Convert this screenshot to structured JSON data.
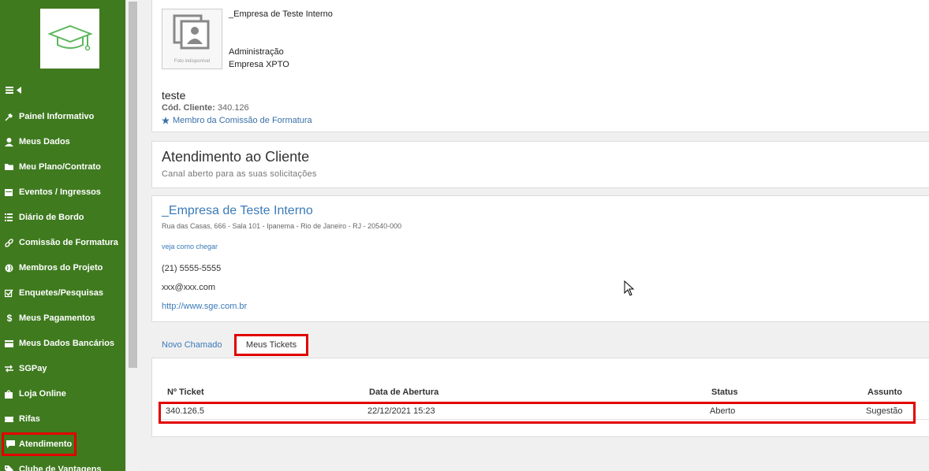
{
  "sidebar": {
    "logo": "graduation-cap-logo",
    "toggle_icons": [
      "hamburger-icon",
      "caret-left-icon"
    ],
    "items": [
      {
        "label": "Painel Informativo",
        "icon": "pin-icon"
      },
      {
        "label": "Meus Dados",
        "icon": "user-icon"
      },
      {
        "label": "Meu Plano/Contrato",
        "icon": "folder-icon"
      },
      {
        "label": "Eventos / Ingressos",
        "icon": "calendar-icon"
      },
      {
        "label": "Diário de Bordo",
        "icon": "list-icon"
      },
      {
        "label": "Comissão de Formatura",
        "icon": "link-icon"
      },
      {
        "label": "Membros do Projeto",
        "icon": "globe-icon"
      },
      {
        "label": "Enquetes/Pesquisas",
        "icon": "checkbox-icon"
      },
      {
        "label": "Meus Pagamentos",
        "icon": "dollar-icon"
      },
      {
        "label": "Meus Dados Bancários",
        "icon": "card-icon"
      },
      {
        "label": "SGPay",
        "icon": "transfer-icon"
      },
      {
        "label": "Loja Online",
        "icon": "bag-icon"
      },
      {
        "label": "Rifas",
        "icon": "ticket-icon"
      },
      {
        "label": "Atendimento",
        "icon": "comment-icon",
        "active": true
      },
      {
        "label": "Clube de Vantagens",
        "icon": "tag-icon"
      }
    ]
  },
  "profile": {
    "photo_caption": "Foto indisponível",
    "company": "_Empresa de Teste Interno",
    "role": "Administração",
    "company_sub": "Empresa XPTO",
    "username": "teste",
    "client_code_label": "Cód. Cliente:",
    "client_code": "340.126",
    "member_role": "Membro da Comissão de Formatura"
  },
  "service": {
    "title": "Atendimento ao Cliente",
    "subtitle": "Canal aberto para as suas solicitações"
  },
  "company_info": {
    "name": "_Empresa de Teste Interno",
    "address": "Rua das Casas, 666 - Sala 101 - Ipanema - Rio de Janeiro - RJ - 20540-000",
    "map_link": "veja como chegar",
    "phone": "(21) 5555-5555",
    "email": "xxx@xxx.com",
    "website": "http://www.sge.com.br"
  },
  "tabs": {
    "new": "Novo Chamado",
    "mine": "Meus Tickets"
  },
  "tickets": {
    "headers": [
      "Nº Ticket",
      "Data de Abertura",
      "Status",
      "Assunto"
    ],
    "rows": [
      [
        "340.126.5",
        "22/12/2021 15:23",
        "Aberto",
        "Sugestão"
      ]
    ]
  },
  "colors": {
    "sidebar_bg": "#3f7a1f",
    "highlight": "#e10000",
    "link": "#3a7ab8"
  }
}
